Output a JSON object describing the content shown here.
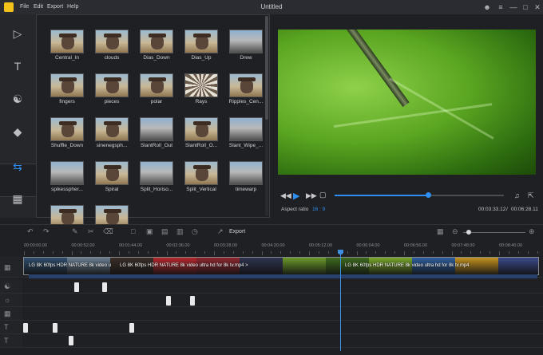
{
  "app": {
    "title": "Untitled",
    "menu": [
      "File",
      "Edit",
      "Export",
      "Help"
    ]
  },
  "library": {
    "items": [
      {
        "label": "Central_In",
        "style": "dog"
      },
      {
        "label": "clouds",
        "style": "dog"
      },
      {
        "label": "Dias_Down",
        "style": "dog"
      },
      {
        "label": "Dias_Up",
        "style": "dog"
      },
      {
        "label": "Drew",
        "style": "road"
      },
      {
        "label": "fingers",
        "style": "dog"
      },
      {
        "label": "pieces",
        "style": "dog"
      },
      {
        "label": "polar",
        "style": "dog"
      },
      {
        "label": "Rays",
        "style": "swirl"
      },
      {
        "label": "Ripples_Cen...",
        "style": "dog"
      },
      {
        "label": "Shuffle_Down",
        "style": "dog"
      },
      {
        "label": "sinenegsph...",
        "style": "dog"
      },
      {
        "label": "SlantRoll_Out",
        "style": "road"
      },
      {
        "label": "SlantRoll_O...",
        "style": "dog"
      },
      {
        "label": "Slant_Wipe_...",
        "style": "road"
      },
      {
        "label": "spikesspher...",
        "style": "road"
      },
      {
        "label": "Spiral",
        "style": "dog"
      },
      {
        "label": "Split_Horiso...",
        "style": "road"
      },
      {
        "label": "Split_Vertical",
        "style": "dog"
      },
      {
        "label": "timewarp",
        "style": "road"
      },
      {
        "label": "",
        "style": "dog"
      },
      {
        "label": "",
        "style": "dog"
      }
    ]
  },
  "player": {
    "aspect_label": "Aspect ratio",
    "aspect_value": "16 : 9",
    "current_time": "00:03:33.12",
    "separator": "/",
    "total_time": "00:06:28.11",
    "progress_fraction": 0.55
  },
  "timeline": {
    "export_label": "Export",
    "ruler": [
      "00:00:00.00",
      "00:00:52.00",
      "00:01:44.00",
      "00:02:36.00",
      "00:03:28.00",
      "00:04:20.00",
      "00:05:12.00",
      "00:06:04.00",
      "00:06:56.00",
      "00:07:48.00",
      "00:08:40.00",
      "00:09:32.00"
    ],
    "clips": [
      {
        "label": "LG 8K 60fps HDR NATURE 8k video u",
        "color": "#3f5b7a"
      },
      {
        "label": "LG 8K 60fps HDR NATURE 8k video ultra hd for 8k tv.mp4 >",
        "color": "#6a2530"
      },
      {
        "label": "LG 8K 60fps HDR NATURE 8k video ultra hd for 8k tv.mp4",
        "color": "#5a8a2a"
      }
    ],
    "zoom_fraction": 0.05
  },
  "colors": {
    "accent": "#2f8ff0",
    "app_logo": "#f2c21b"
  }
}
